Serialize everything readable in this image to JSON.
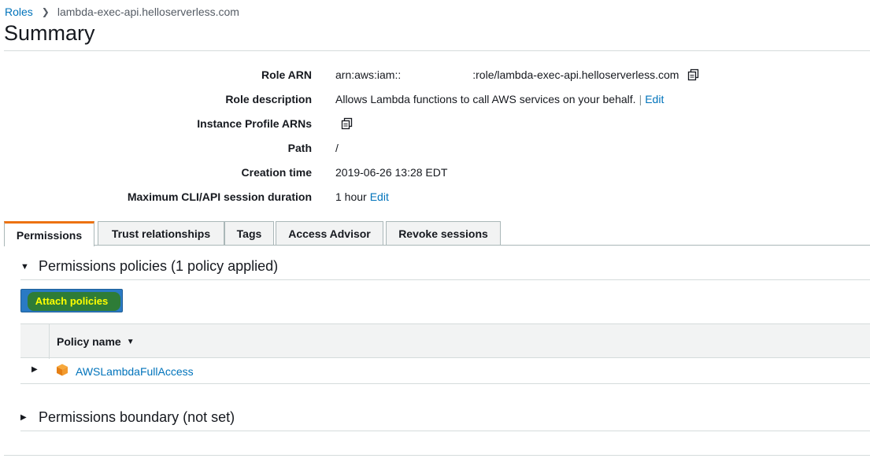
{
  "breadcrumb": {
    "root": "Roles",
    "current": "lambda-exec-api.helloserverless.com"
  },
  "page_title": "Summary",
  "summary": {
    "role_arn_label": "Role ARN",
    "role_arn_prefix": "arn:aws:iam::",
    "role_arn_suffix": ":role/lambda-exec-api.helloserverless.com",
    "role_description_label": "Role description",
    "role_description_value": "Allows Lambda functions to call AWS services on your behalf.",
    "role_description_separator": "|",
    "role_description_edit": "Edit",
    "instance_profile_label": "Instance Profile ARNs",
    "path_label": "Path",
    "path_value": "/",
    "creation_time_label": "Creation time",
    "creation_time_value": "2019-06-26 13:28 EDT",
    "session_duration_label": "Maximum CLI/API session duration",
    "session_duration_value": "1 hour",
    "session_duration_edit": "Edit"
  },
  "tabs": [
    {
      "label": "Permissions",
      "active": true
    },
    {
      "label": "Trust relationships",
      "active": false
    },
    {
      "label": "Tags",
      "active": false
    },
    {
      "label": "Access Advisor",
      "active": false
    },
    {
      "label": "Revoke sessions",
      "active": false
    }
  ],
  "permissions": {
    "policies_heading": "Permissions policies (1 policy applied)",
    "attach_button": "Attach policies",
    "table_header": "Policy name",
    "policies": [
      "AWSLambdaFullAccess"
    ],
    "boundary_heading": "Permissions boundary (not set)"
  },
  "icons": {
    "copy": "copy-icon",
    "package": "package-icon",
    "accent_color": "#ec7211",
    "link_color": "#0073bb"
  }
}
